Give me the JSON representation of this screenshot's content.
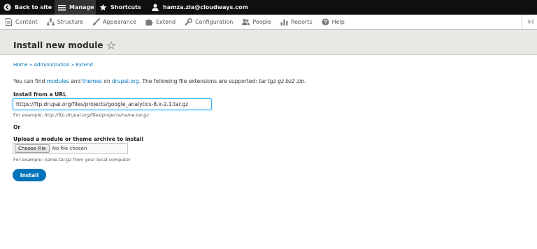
{
  "toolbar": {
    "back_label": "Back to site",
    "manage_label": "Manage",
    "shortcuts_label": "Shortcuts",
    "user_label": "hamza.zia@cloudways.com",
    "icons": [
      "back-arrow-icon",
      "hamburger-menu-icon",
      "star-icon",
      "user-icon"
    ]
  },
  "tray": {
    "items": [
      {
        "label": "Content",
        "icon": "document-icon"
      },
      {
        "label": "Structure",
        "icon": "sitemap-icon"
      },
      {
        "label": "Appearance",
        "icon": "paintbrush-icon"
      },
      {
        "label": "Extend",
        "icon": "puzzle-icon"
      },
      {
        "label": "Configuration",
        "icon": "wrench-icon"
      },
      {
        "label": "People",
        "icon": "people-icon"
      },
      {
        "label": "Reports",
        "icon": "bar-chart-icon"
      },
      {
        "label": "Help",
        "icon": "help-icon"
      }
    ],
    "toggle_icon": "collapse-tray-icon"
  },
  "page": {
    "title": "Install new module"
  },
  "breadcrumb": {
    "items": [
      "Home",
      "Administration",
      "Extend"
    ],
    "separator": "»"
  },
  "intro": {
    "prefix": "You can find ",
    "link_modules": "modules",
    "and": " and ",
    "link_themes": "themes",
    "on": " on ",
    "link_drupal": "drupal.org",
    "middle": ". The following file extensions are supported: ",
    "extensions": "tar tgz gz bz2 zip",
    "suffix": "."
  },
  "form": {
    "url_label": "Install from a URL",
    "url_value": "https://ftp.drupal.org/files/projects/google_analytics-8.x-2.1.tar.gz",
    "url_hint_prefix": "For example: ",
    "url_hint_example": "http://ftp.drupal.org/files/projects/name.tar.gz",
    "or_label": "Or",
    "upload_label": "Upload a module or theme archive to install",
    "choose_file_label": "Choose File",
    "file_status": "No file chosen",
    "upload_hint_prefix": "For example: ",
    "upload_hint_example": "name.tar.gz",
    "upload_hint_suffix": " from your local computer",
    "install_label": "Install"
  },
  "colors": {
    "toolbar_bg": "#0f0f0f",
    "link": "#0074bd",
    "primary_button": "#0073ba",
    "header_band": "#e9e8e4",
    "input_focus": "#40b6ff"
  }
}
